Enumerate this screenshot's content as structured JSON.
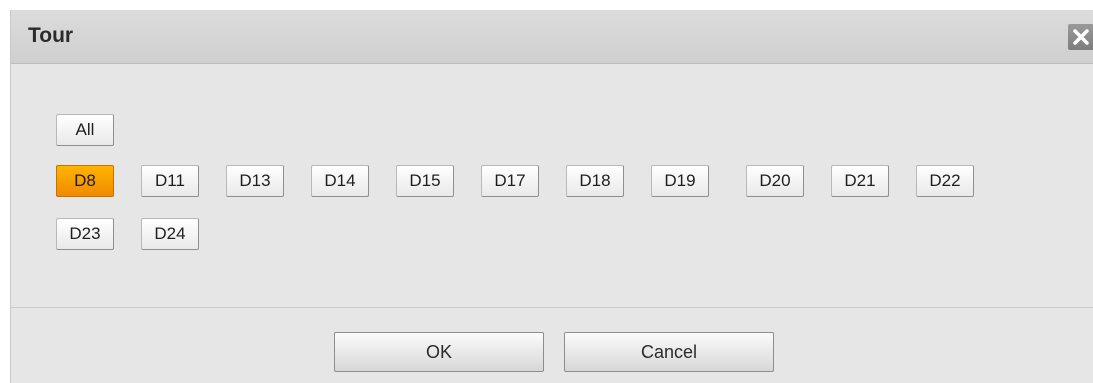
{
  "dialog": {
    "title": "Tour",
    "close_icon": "close-icon"
  },
  "channels": {
    "all_label": "All",
    "items": [
      {
        "label": "D8",
        "selected": true
      },
      {
        "label": "D11",
        "selected": false
      },
      {
        "label": "D13",
        "selected": false
      },
      {
        "label": "D14",
        "selected": false
      },
      {
        "label": "D15",
        "selected": false
      },
      {
        "label": "D17",
        "selected": false
      },
      {
        "label": "D18",
        "selected": false
      },
      {
        "label": "D19",
        "selected": false
      },
      {
        "label": "D20",
        "selected": false
      },
      {
        "label": "D21",
        "selected": false
      },
      {
        "label": "D22",
        "selected": false
      },
      {
        "label": "D23",
        "selected": false
      },
      {
        "label": "D24",
        "selected": false
      }
    ]
  },
  "footer": {
    "ok_label": "OK",
    "cancel_label": "Cancel"
  },
  "colors": {
    "selected": "#f7a000",
    "dialog_bg": "#e6e6e6",
    "titlebar_bg": "#d4d4d4"
  }
}
